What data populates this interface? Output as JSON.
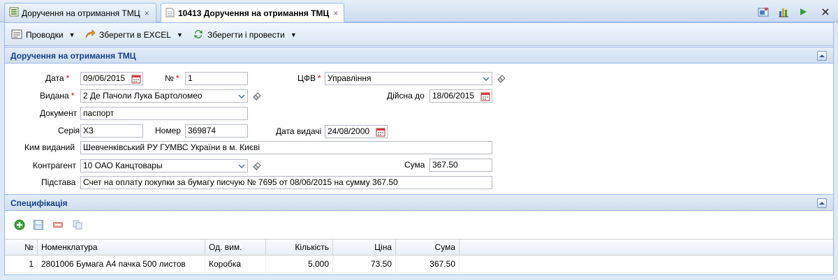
{
  "tabs": [
    {
      "label": "Доручення на отримання ТМЦ",
      "close": "×"
    },
    {
      "label": "10413 Доручення на отримання ТМЦ",
      "close": "×"
    }
  ],
  "toolbar": {
    "postings_label": "Проводки",
    "excel_label": "Зберегти в EXCEL",
    "save_post_label": "Зберегти і провести"
  },
  "header_section": {
    "title": "Доручення на отримання ТМЦ"
  },
  "form": {
    "date_label": "Дата",
    "date_value": "09/06/2015",
    "number_label": "№",
    "number_value": "1",
    "cfv_label": "ЦФВ",
    "cfv_value": "Управління",
    "issued_label": "Видана",
    "issued_value": "2 Де Пачоли Лука Бартоломео",
    "valid_until_label": "Дійсна до",
    "valid_until_value": "18/06/2015",
    "document_label": "Документ",
    "document_value": "паспорт",
    "series_label": "Серія",
    "series_value": "ХЗ",
    "doc_number_label": "Номер",
    "doc_number_value": "369874",
    "issue_date_label": "Дата видачі",
    "issue_date_value": "24/08/2000",
    "issued_by_label": "Ким виданий",
    "issued_by_value": "Шевченківський РУ ГУМВС України в м. Києві",
    "contractor_label": "Контрагент",
    "contractor_value": "10 ОАО Канцтовары",
    "sum_label": "Сума",
    "sum_value": "367.50",
    "basis_label": "Підстава",
    "basis_value": "Счет на оплату покупки за бумагу писчую № 7695 от 08/06/2015 на сумму 367.50",
    "required_mark": "*"
  },
  "spec_section": {
    "title": "Специфікація"
  },
  "grid": {
    "columns": [
      "№",
      "Номенклатура",
      "Од. вим.",
      "Кількість",
      "Ціна",
      "Сума"
    ],
    "rows": [
      [
        "1",
        "2801006 Бумага А4 пачка 500 листов",
        "Коробка",
        "5.000",
        "73.50",
        "367.50"
      ]
    ]
  },
  "colors": {
    "accent_border": "#99bbe8",
    "header_text": "#15428b",
    "required": "#dd0000"
  }
}
